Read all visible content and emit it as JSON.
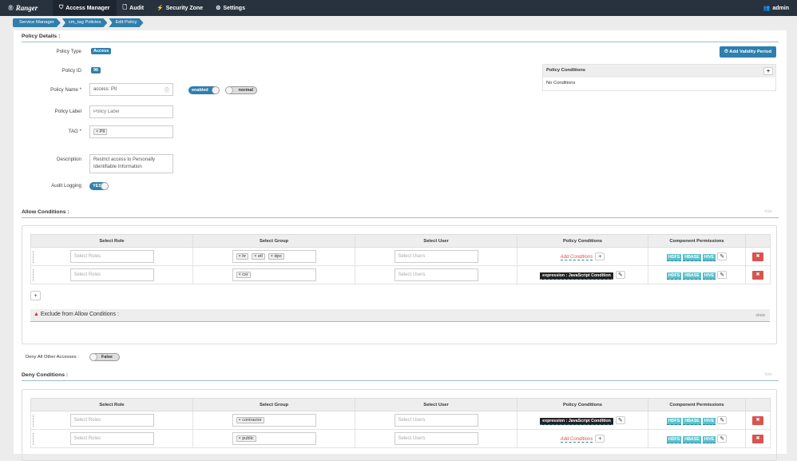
{
  "nav": {
    "brand": "Ranger",
    "items": [
      {
        "label": "Access Manager",
        "icon": "shield-icon"
      },
      {
        "label": "Audit",
        "icon": "file-icon"
      },
      {
        "label": "Security Zone",
        "icon": "zone-icon"
      },
      {
        "label": "Settings",
        "icon": "gear-icon"
      }
    ],
    "user": "admin"
  },
  "breadcrumb": [
    "Service Manager",
    "cm_tag Policies",
    "Edit Policy"
  ],
  "details": {
    "title": "Policy Details :",
    "policy_type_label": "Policy Type",
    "policy_type": "Access",
    "policy_id_label": "Policy ID",
    "policy_id": "96",
    "policy_name_label": "Policy Name *",
    "policy_name": "access: PII",
    "enabled": "enabled",
    "normal": "normal",
    "policy_label_label": "Policy Label",
    "policy_label_placeholder": "Policy Label",
    "tag_label": "TAG *",
    "tag": "PII",
    "description_label": "Description",
    "description": "Restrict access to Personally Identifiable Information",
    "audit_label": "Audit Logging",
    "audit": "YES",
    "add_validity": "Add Validity Period",
    "conditions_title": "Policy Conditions",
    "no_conditions": "No Conditions"
  },
  "columns": [
    "Select Role",
    "Select Group",
    "Select User",
    "Policy Conditions",
    "Component Permissions"
  ],
  "placeholders": {
    "roles": "Select Roles",
    "users": "Select Users"
  },
  "permissions": [
    "HDFS",
    "HBASE",
    "HIVE"
  ],
  "allow": {
    "title": "Allow Conditions :",
    "hide": "hide",
    "rows": [
      {
        "groups": [
          "hr",
          "etl",
          "dpo"
        ],
        "condition": "Add Conditions"
      },
      {
        "groups": [
          "csr"
        ],
        "condition": "expression : JavaScript Condition"
      }
    ],
    "exclude_title": "Exclude from Allow Conditions :",
    "show": "show"
  },
  "deny_all": {
    "label": "Deny All Other Accesses :",
    "value": "False"
  },
  "deny": {
    "title": "Deny Conditions :",
    "hide": "hide",
    "rows": [
      {
        "groups": [
          "contractor"
        ],
        "condition": "expression : JavaScript Condition"
      },
      {
        "groups": [
          "public"
        ],
        "condition": "Add Conditions"
      }
    ]
  }
}
